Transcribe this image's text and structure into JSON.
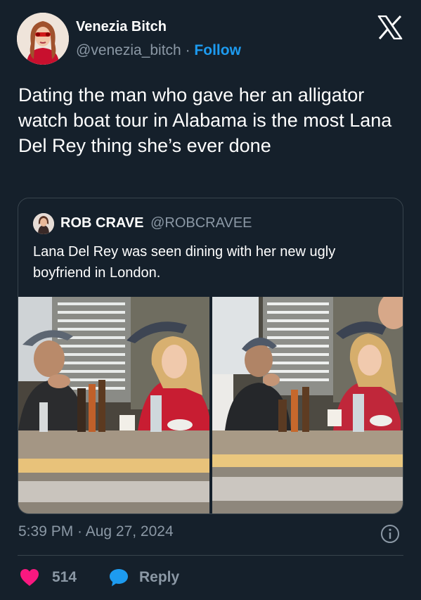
{
  "author": {
    "display_name": "Venezia Bitch",
    "handle": "@venezia_bitch",
    "separator": " · ",
    "follow_label": "Follow"
  },
  "tweet": {
    "text": "Dating the man who gave her an alligator watch boat tour in Alabama is the most Lana Del Rey thing she’s ever done",
    "timestamp": "5:39 PM · Aug 27, 2024"
  },
  "quoted_tweet": {
    "display_name": "ROB CRAVE",
    "handle": "@ROBCRAVEE",
    "text": "Lana Del Rey was seen dining with her new ugly boyfriend in London."
  },
  "actions": {
    "like_count": "514",
    "reply_label": "Reply"
  },
  "icons": {
    "brand": "x-logo-icon",
    "info": "info-icon",
    "like": "heart-icon",
    "reply": "speech-bubble-icon"
  },
  "colors": {
    "background": "#15202b",
    "text_primary": "#ffffff",
    "text_secondary": "#8b98a5",
    "accent": "#1d9bf0",
    "like": "#f91880",
    "border": "#38444d"
  }
}
